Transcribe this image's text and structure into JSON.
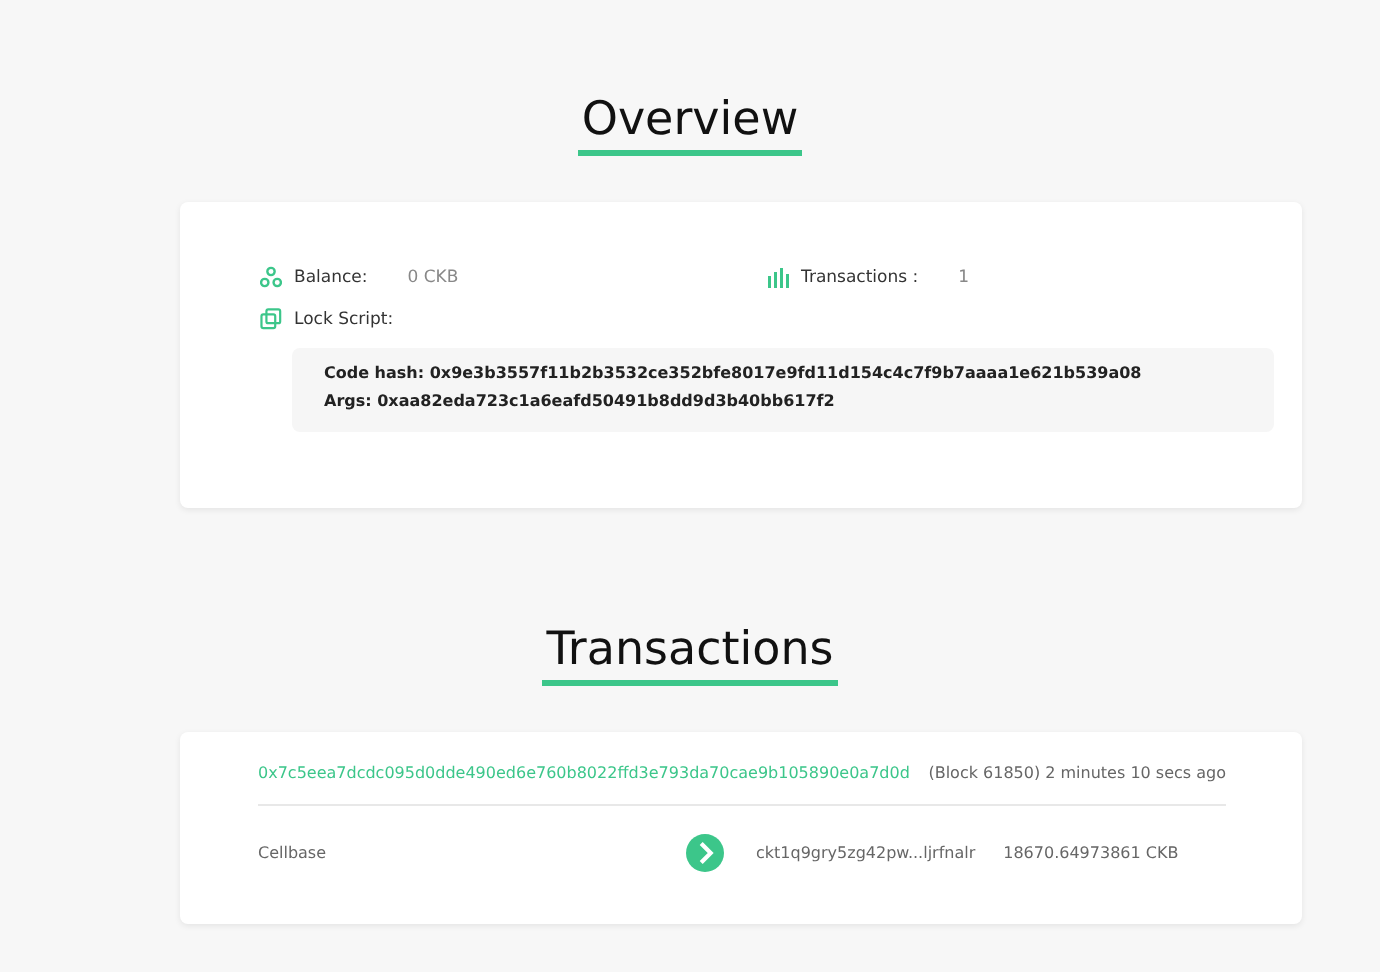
{
  "overview": {
    "title": "Overview",
    "balance_label": "Balance:",
    "balance_value": "0 CKB",
    "transactions_label": "Transactions :",
    "transactions_value": "1",
    "lock_script_label": "Lock Script:",
    "code_hash": "Code hash: 0x9e3b3557f11b2b3532ce352bfe8017e9fd11d154c4c7f9b7aaaa1e621b539a08",
    "args": "Args: 0xaa82eda723c1a6eafd50491b8dd9d3b40bb617f2"
  },
  "transactions": {
    "title": "Transactions",
    "items": [
      {
        "hash": "0x7c5eea7dcdc095d0dde490ed6e760b8022ffd3e793da70cae9b105890e0a7d0d",
        "block_info": "(Block 61850) 2 minutes 10 secs ago",
        "input": "Cellbase",
        "output_address": "ckt1q9gry5zg42pw...ljrfnalr",
        "output_amount": "18670.64973861 CKB"
      }
    ]
  }
}
